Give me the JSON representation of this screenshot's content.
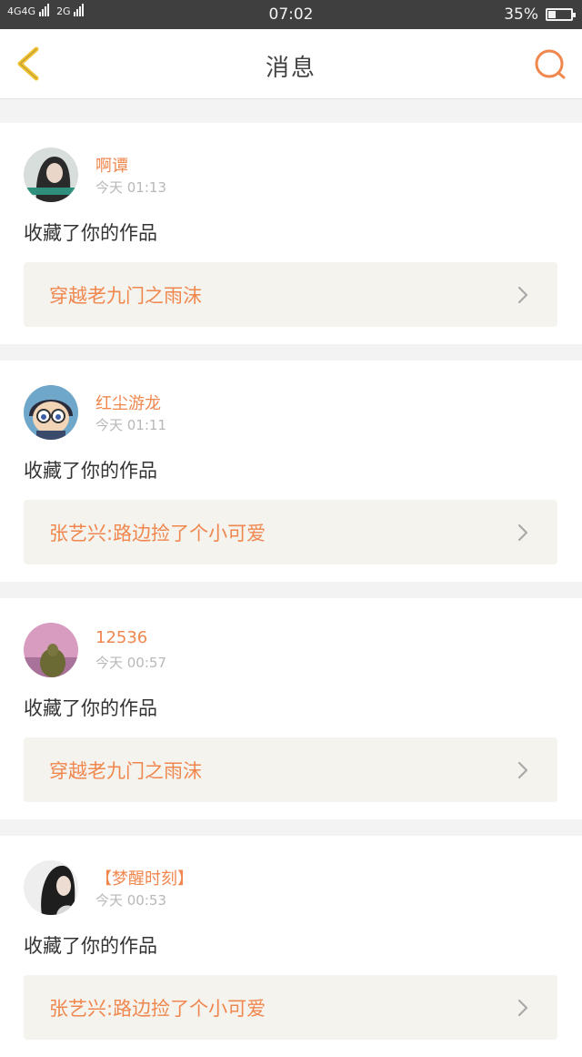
{
  "status_bar": {
    "network1": "4G",
    "network2": "4G",
    "network3": "2G",
    "time": "07:02",
    "battery_percent": "35%",
    "battery_level": 0.35
  },
  "header": {
    "title": "消息",
    "back_icon": "chevron-left-icon",
    "search_icon": "search-icon"
  },
  "colors": {
    "accent": "#f0874e",
    "back_icon": "#f1c232",
    "link_bg": "#f4f3ee"
  },
  "messages": [
    {
      "username": "啊谭",
      "timestamp": "今天 01:13",
      "action": "收藏了你的作品",
      "work_title": "穿越老九门之雨沫"
    },
    {
      "username": "红尘游龙",
      "timestamp": "今天 01:11",
      "action": "收藏了你的作品",
      "work_title": "张艺兴:路边捡了个小可爱"
    },
    {
      "username": "12536",
      "timestamp": "今天 00:57",
      "action": "收藏了你的作品",
      "work_title": "穿越老九门之雨沫"
    },
    {
      "username": "【梦醒时刻】",
      "timestamp": "今天 00:53",
      "action": "收藏了你的作品",
      "work_title": "张艺兴:路边捡了个小可爱"
    }
  ]
}
